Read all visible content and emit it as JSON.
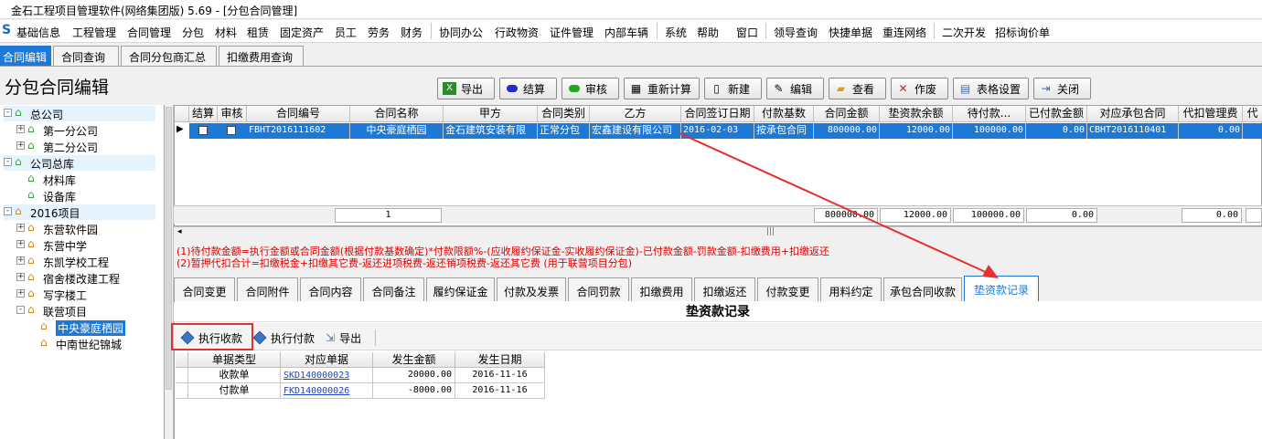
{
  "window": {
    "title": "金石工程项目管理软件(网络集团版) 5.69 - [分包合同管理]"
  },
  "menu": [
    "基础信息",
    "工程管理",
    "合同管理",
    "分包",
    "材料",
    "租赁",
    "固定资产",
    "员工",
    "劳务",
    "财务",
    "协同办公",
    "行政物资",
    "证件管理",
    "内部车辆",
    "系统",
    "帮助",
    "窗口",
    "领导查询",
    "快捷单据",
    "重连网络",
    "二次开发",
    "招标询价单"
  ],
  "top_tabs": [
    "合同编辑",
    "合同查询",
    "合同分包商汇总",
    "扣缴费用查询"
  ],
  "page_title": "分包合同编辑",
  "toolbar": {
    "export": "导出",
    "settle": "结算",
    "audit": "审核",
    "recalc": "重新计算",
    "new": "新建",
    "edit": "编辑",
    "view": "查看",
    "void": "作废",
    "table_settings": "表格设置",
    "close": "关闭"
  },
  "tree": [
    {
      "label": "总公司",
      "level": 0,
      "exp": "-",
      "icon": "green"
    },
    {
      "label": "第一分公司",
      "level": 1,
      "exp": "+",
      "icon": "green"
    },
    {
      "label": "第二分公司",
      "level": 1,
      "exp": "+",
      "icon": "green"
    },
    {
      "label": "公司总库",
      "level": 0,
      "exp": "-",
      "icon": "green"
    },
    {
      "label": "材料库",
      "level": 1,
      "exp": "",
      "icon": "green"
    },
    {
      "label": "设备库",
      "level": 1,
      "exp": "",
      "icon": "green"
    },
    {
      "label": "2016项目",
      "level": 0,
      "exp": "-",
      "icon": "orange"
    },
    {
      "label": "东营软件园",
      "level": 1,
      "exp": "+",
      "icon": "orange"
    },
    {
      "label": "东营中学",
      "level": 1,
      "exp": "+",
      "icon": "orange"
    },
    {
      "label": "东凯学校工程",
      "level": 1,
      "exp": "+",
      "icon": "orange"
    },
    {
      "label": "宿舍楼改建工程",
      "level": 1,
      "exp": "+",
      "icon": "orange"
    },
    {
      "label": "写字楼工",
      "level": 1,
      "exp": "+",
      "icon": "orange"
    },
    {
      "label": "联营项目",
      "level": 1,
      "exp": "-",
      "icon": "orange"
    },
    {
      "label": "中央豪庭栖园",
      "level": 2,
      "exp": "",
      "icon": "orange",
      "selected": true
    },
    {
      "label": "中南世纪锦城",
      "level": 2,
      "exp": "",
      "icon": "orange"
    }
  ],
  "grid": {
    "columns": [
      "结算",
      "审核",
      "合同编号",
      "合同名称",
      "甲方",
      "合同类别",
      "乙方",
      "合同签订日期",
      "付款基数",
      "合同金额",
      "垫资款余额",
      "待付款...",
      "已付款金额",
      "对应承包合同",
      "代扣管理费",
      "代"
    ],
    "row": {
      "contract_no": "FBHT2016111602",
      "name": "中央豪庭栖园",
      "party_a": "金石建筑安装有限",
      "category": "正常分包",
      "party_b": "宏鑫建设有限公司",
      "date": "2016-02-03",
      "base": "按承包合同",
      "amount": "800000.00",
      "advance_balance": "12000.00",
      "pending": "100000.00",
      "paid": "0.00",
      "main_contract": "CBHT2016110401",
      "mgmt_fee": "0.00"
    },
    "summary": {
      "count": "1",
      "amount": "800000.00",
      "advance_balance": "12000.00",
      "pending": "100000.00",
      "paid": "0.00",
      "mgmt_fee": "0.00"
    }
  },
  "notes": [
    "(1)待付款金额=执行金额或合同金额(根据付款基数确定)*付款限额%-(应收履约保证金-实收履约保证金)-已付款金额-罚款金额-扣缴费用+扣缴返还",
    "(2)暂押代扣合计=扣缴税金+扣缴其它费-返还进项税费-返还销项税费-返还其它费 (用于联营项目分包)"
  ],
  "sub_tabs": [
    "合同变更",
    "合同附件",
    "合同内容",
    "合同备注",
    "履约保证金",
    "付款及发票",
    "合同罚款",
    "扣缴费用",
    "扣缴返还",
    "付款变更",
    "用料约定",
    "承包合同收款",
    "垫资款记录"
  ],
  "sub_panel": {
    "title": "垫资款记录",
    "buttons": {
      "exec_receive": "执行收款",
      "exec_pay": "执行付款",
      "export": "导出"
    },
    "columns": [
      "单据类型",
      "对应单据",
      "发生金额",
      "发生日期"
    ],
    "rows": [
      {
        "type": "收款单",
        "doc": "SKD140000023",
        "amount": "20000.00",
        "date": "2016-11-16"
      },
      {
        "type": "付款单",
        "doc": "FKD140000026",
        "amount": "-8000.00",
        "date": "2016-11-16"
      }
    ]
  },
  "colors": {
    "accent": "#1e78d6",
    "annotation": "#e53030",
    "note_text": "#e00000"
  }
}
